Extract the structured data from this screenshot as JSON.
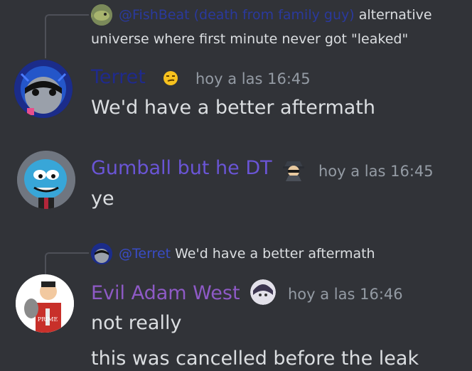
{
  "colors": {
    "background": "#313338",
    "text": "#dbdee1",
    "muted": "#949ba4",
    "terret_name": "#1f2a8c",
    "gumball_name": "#6a55d6",
    "evil_adam_name": "#8e5ac6",
    "fishbeat_mention": "#2a3aa8",
    "terret_mention": "#3a4fd6"
  },
  "messages": [
    {
      "reply": {
        "mention": "@FishBeat (death from family guy)",
        "text_line1": "alternative",
        "text_line2": "universe where first minute never got \"leaked\"",
        "avatar_icon": "fish-avatar-icon"
      },
      "author": "Terret",
      "badge_icon": "smirk-emoji-icon",
      "timestamp": "hoy a las 16:45",
      "lines": [
        "We'd have a better aftermath"
      ]
    },
    {
      "author": "Gumball but he DT",
      "badge_icon": "spy-emoji-icon",
      "timestamp": "hoy a las 16:45",
      "lines": [
        "ye"
      ]
    },
    {
      "reply": {
        "mention": "@Terret",
        "text": "We'd have a better aftermath",
        "avatar_icon": "terret-avatar-icon"
      },
      "author": "Evil Adam West",
      "badge_icon": "dark-face-badge-icon",
      "timestamp": "hoy a las 16:46",
      "lines": [
        "not really",
        "this was cancelled before the leak"
      ],
      "avatar_label": "PRIME"
    }
  ]
}
